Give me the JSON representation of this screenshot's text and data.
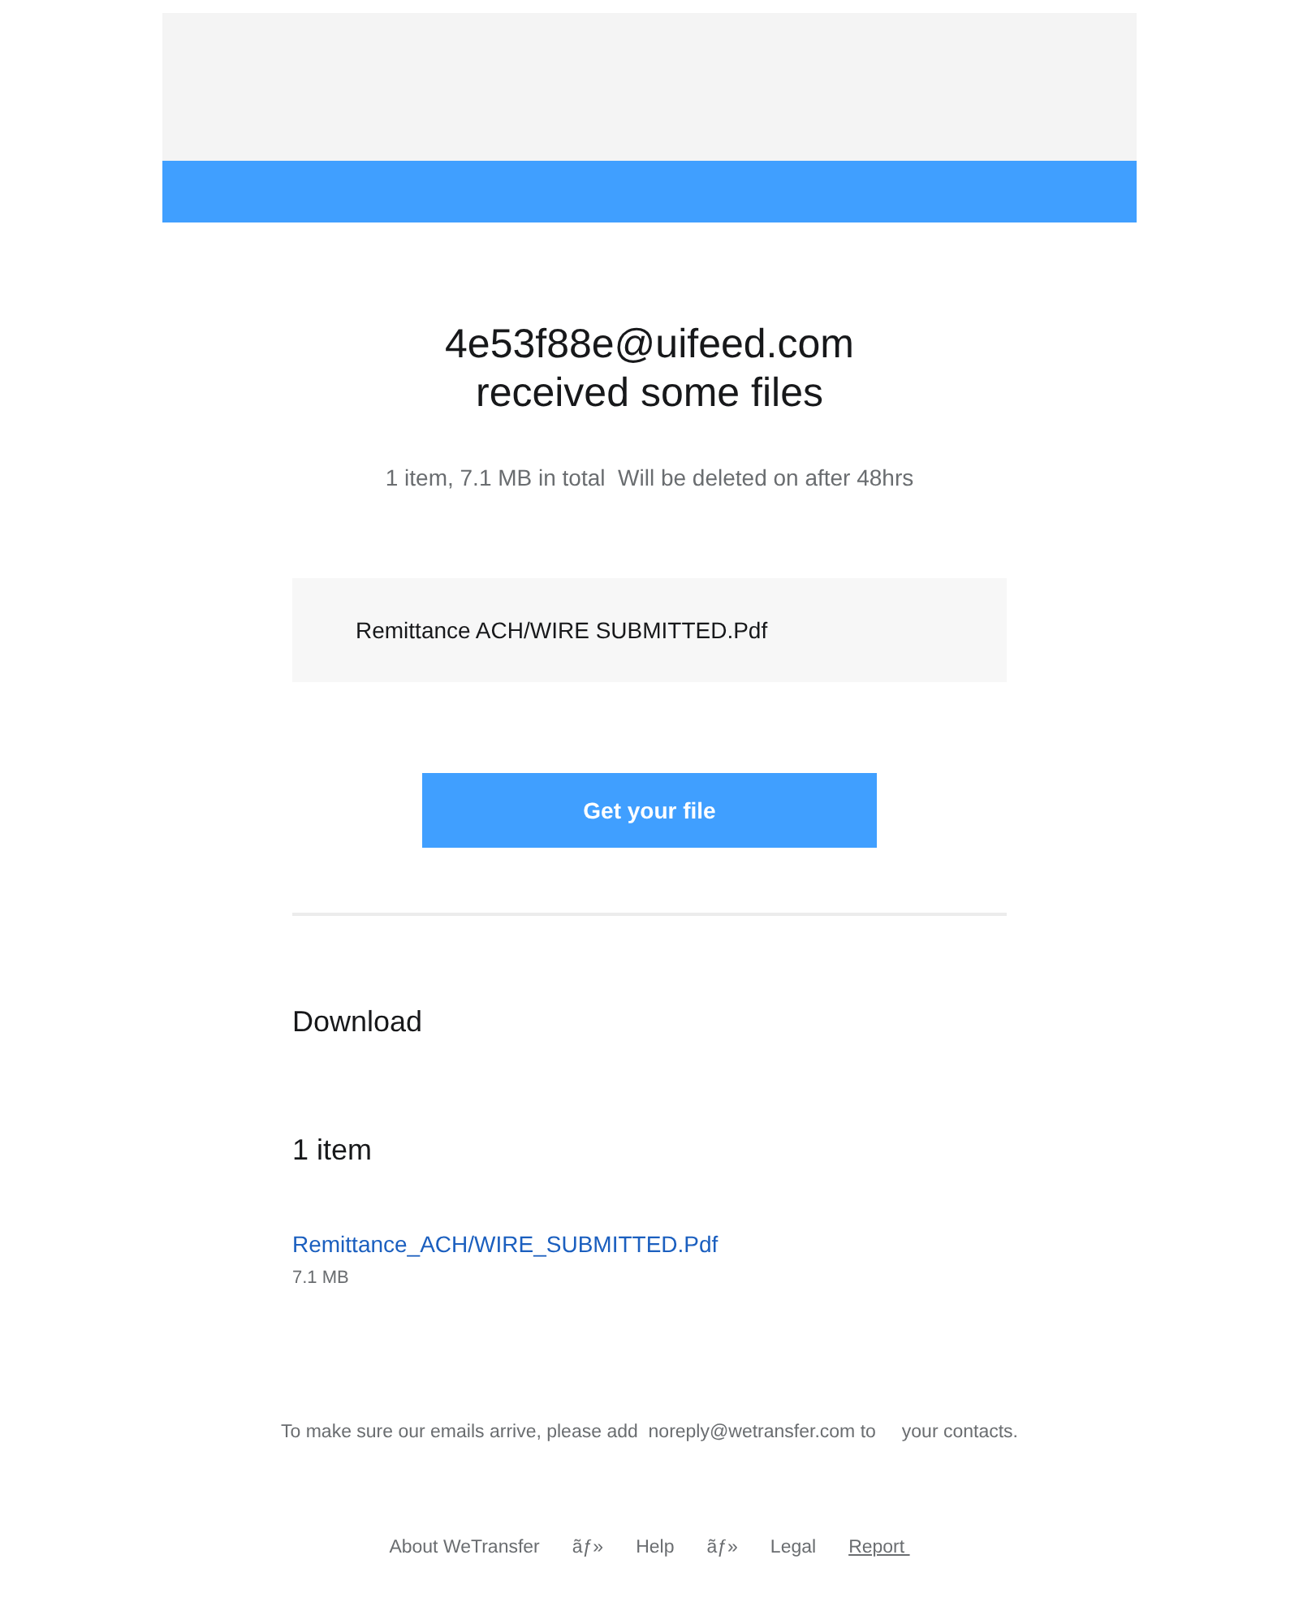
{
  "heading": {
    "lines": [
      "4e53f88e@uifeed.com",
      "received some files"
    ]
  },
  "summary": "1 item, 7.1 MB in total  Will be deleted on after 48hrs",
  "file_box": {
    "name": "Remittance ACH/WIRE SUBMITTED.Pdf"
  },
  "button": "Get your file",
  "download": {
    "title": "Download",
    "count": "1 item",
    "files": [
      {
        "name": "Remittance_ACH/WIRE_SUBMITTED.Pdf",
        "size": "7.1 MB"
      }
    ]
  },
  "notice": "To make sure our emails arrive, please add  noreply@wetransfer.com to     your contacts.",
  "footer_links": [
    {
      "kind": "link",
      "text": "About WeTransfer",
      "underlined": false
    },
    {
      "kind": "separator",
      "text": "ãƒ»"
    },
    {
      "kind": "link",
      "text": "Help",
      "underlined": false
    },
    {
      "kind": "separator",
      "text": "ãƒ»"
    },
    {
      "kind": "link",
      "text": "Legal",
      "underlined": false
    },
    {
      "kind": "link",
      "text": "Report ",
      "underlined": true
    }
  ]
}
